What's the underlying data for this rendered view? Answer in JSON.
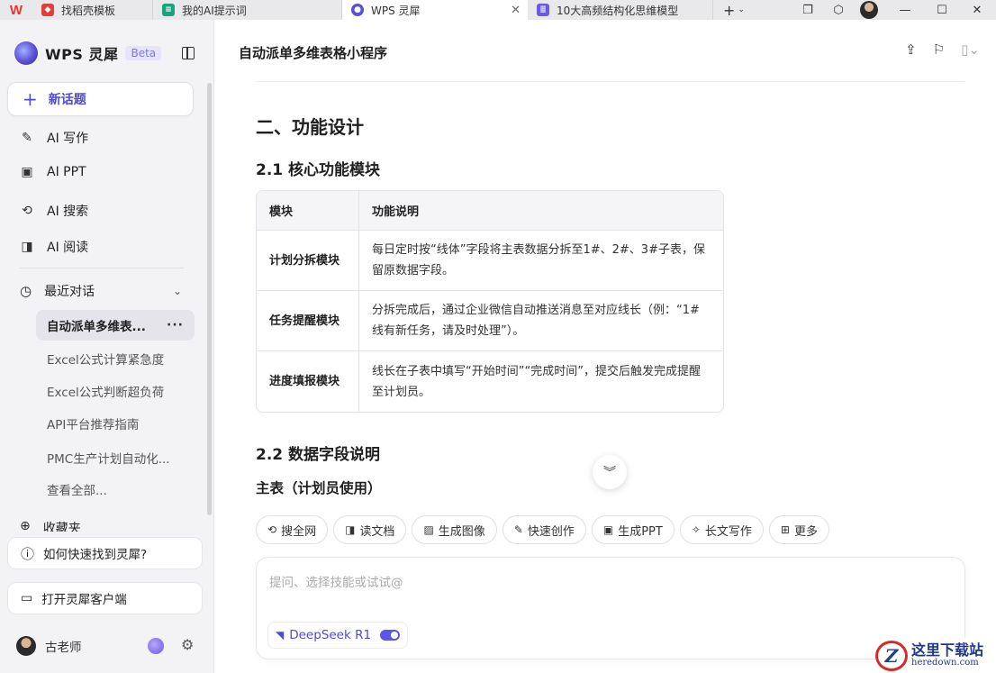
{
  "tabs": [
    {
      "label": "找稻壳模板",
      "active": false,
      "icon_color": "#e0403a"
    },
    {
      "label": "我的AI提示词",
      "active": false,
      "icon_color": "#16a37f"
    },
    {
      "label": "WPS 灵犀",
      "active": true,
      "icon_color": "#5a4fd6"
    },
    {
      "label": "10大高频结构化思维模型",
      "active": false,
      "icon_color": "#6a5ae0"
    }
  ],
  "sidebar": {
    "brand": "WPS 灵犀",
    "beta": "Beta",
    "new_topic": "新话题",
    "nav": [
      {
        "label": "AI 写作",
        "icon": "pen-sparkle-icon"
      },
      {
        "label": "AI PPT",
        "icon": "ppt-icon"
      },
      {
        "label": "AI 搜索",
        "icon": "search-icon"
      },
      {
        "label": "AI 阅读",
        "icon": "book-icon"
      }
    ],
    "recent_label": "最近对话",
    "history": [
      "自动派单多维表...",
      "Excel公式计算紧急度",
      "Excel公式判断超负荷",
      "API平台推荐指南",
      "PMC生产计划自动化...",
      "查看全部..."
    ],
    "favorites": "收藏夹",
    "help": "如何快速找到灵犀?",
    "open_client": "打开灵犀客户端",
    "user_name": "古老师"
  },
  "main": {
    "doc_title": "自动派单多维表格小程序",
    "section_title": "二、功能设计",
    "sub1": "2.1 核心功能模块",
    "table": {
      "headers": [
        "模块",
        "功能说明"
      ],
      "rows": [
        [
          "计划分拆模块",
          "每日定时按“线体”字段将主表数据分拆至1#、2#、3#子表，保留原数据字段。"
        ],
        [
          "任务提醒模块",
          "分拆完成后，通过企业微信自动推送消息至对应线长（例：“1#线有新任务，请及时处理”）。"
        ],
        [
          "进度填报模块",
          "线长在子表中填写“开始时间”“完成时间”，提交后触发完成提醒至计划员。"
        ]
      ]
    },
    "sub2": "2.2 数据字段说明",
    "sub3": "主表（计划员使用）",
    "chips": [
      {
        "label": "搜全网",
        "icon": "search-icon"
      },
      {
        "label": "读文档",
        "icon": "read-doc-icon"
      },
      {
        "label": "生成图像",
        "icon": "image-icon"
      },
      {
        "label": "快速创作",
        "icon": "quick-create-icon"
      },
      {
        "label": "生成PPT",
        "icon": "ppt-icon"
      },
      {
        "label": "长文写作",
        "icon": "long-write-icon"
      },
      {
        "label": "更多",
        "icon": "grid-more-icon"
      }
    ],
    "input_placeholder": "提问、选择技能或试试@",
    "model_name": "DeepSeek R1",
    "model_enabled": true
  },
  "watermark": {
    "cn": "这里下载站",
    "en": "heredown.com",
    "logo": "Z"
  }
}
